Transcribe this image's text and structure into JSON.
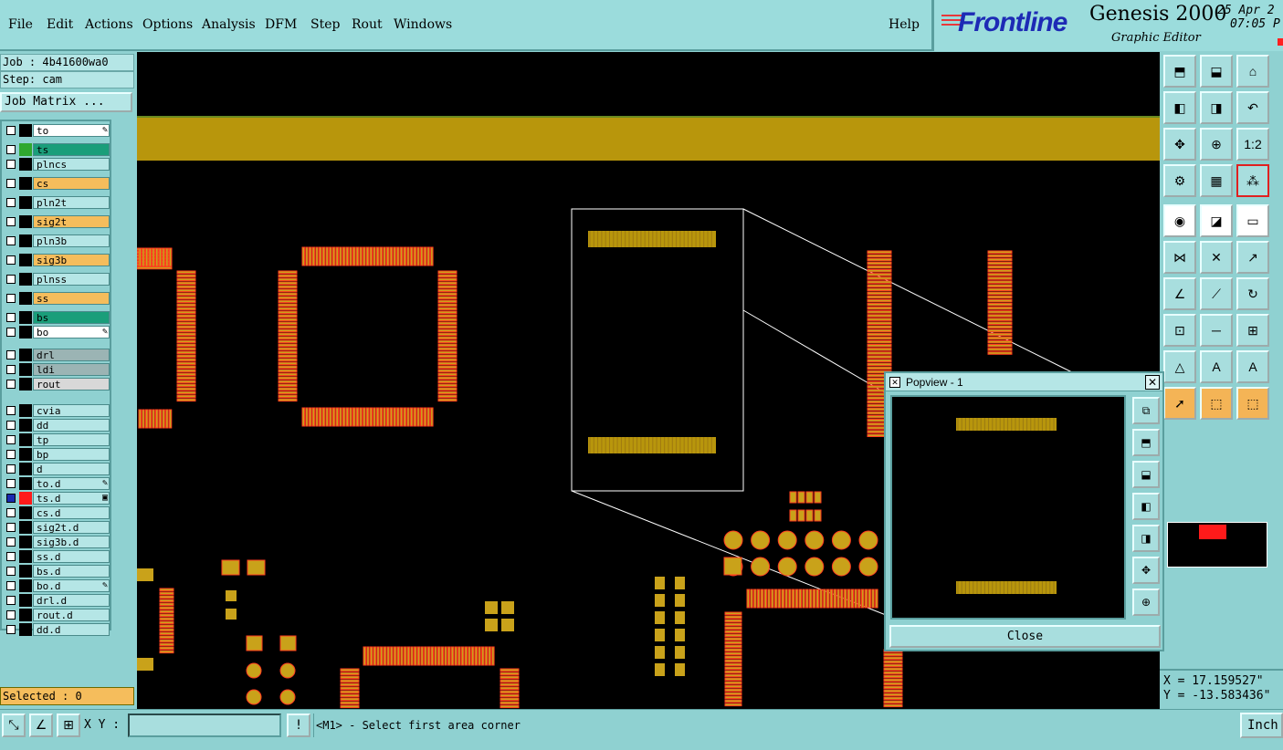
{
  "menu": {
    "items": [
      "File",
      "Edit",
      "Actions",
      "Options",
      "Analysis",
      "DFM",
      "Step",
      "Rout",
      "Windows"
    ],
    "help": "Help"
  },
  "brand": {
    "logo": "Frontline",
    "product": "Genesis 2000",
    "subtitle": "Graphic Editor",
    "date": "25 Apr 2",
    "time": "07:05 P"
  },
  "job": {
    "job_line": "Job : 4b41600wa0",
    "step_line": "Step: cam",
    "matrix_button": "Job Matrix ..."
  },
  "colors": {
    "copper": "#b8960c",
    "pad_fill": "#c9a21a",
    "pad_edge": "#ff3b1f",
    "layer_orange": "#f5bd5c",
    "layer_green": "#1a9e7a",
    "layer_gray": "#9bb4b4",
    "panel_bg": "#8fd1d1"
  },
  "layers": [
    {
      "name": "to",
      "style": "white",
      "mark": "✎",
      "swatch": "#000000"
    },
    {
      "name": "ts",
      "style": "green",
      "mark": "",
      "swatch": "#2fa82f"
    },
    {
      "name": "plncs",
      "style": "cyan",
      "mark": "",
      "swatch": "#000000"
    },
    {
      "name": "cs",
      "style": "orange",
      "mark": "",
      "swatch": "#000000"
    },
    {
      "name": "pln2t",
      "style": "cyan",
      "mark": "",
      "swatch": "#000000"
    },
    {
      "name": "sig2t",
      "style": "orange",
      "mark": "",
      "swatch": "#000000"
    },
    {
      "name": "pln3b",
      "style": "cyan",
      "mark": "",
      "swatch": "#000000"
    },
    {
      "name": "sig3b",
      "style": "orange",
      "mark": "",
      "swatch": "#000000"
    },
    {
      "name": "plnss",
      "style": "cyan",
      "mark": "",
      "swatch": "#000000"
    },
    {
      "name": "ss",
      "style": "orange",
      "mark": "",
      "swatch": "#000000"
    },
    {
      "name": "bs",
      "style": "green",
      "mark": "",
      "swatch": "#000000"
    },
    {
      "name": "bo",
      "style": "white",
      "mark": "✎",
      "swatch": "#000000"
    },
    {
      "name": "drl",
      "style": "gray",
      "mark": "",
      "swatch": "#000000"
    },
    {
      "name": "ldi",
      "style": "gray",
      "mark": "",
      "swatch": "#000000"
    },
    {
      "name": "rout",
      "style": "lightgray",
      "mark": "",
      "swatch": "#000000"
    },
    {
      "name": "cvia",
      "style": "cyan",
      "mark": "",
      "swatch": "#000000"
    },
    {
      "name": "dd",
      "style": "cyan",
      "mark": "",
      "swatch": "#000000"
    },
    {
      "name": "tp",
      "style": "cyan",
      "mark": "",
      "swatch": "#000000"
    },
    {
      "name": "bp",
      "style": "cyan",
      "mark": "",
      "swatch": "#000000"
    },
    {
      "name": "d",
      "style": "cyan",
      "mark": "",
      "swatch": "#000000"
    },
    {
      "name": "to.d",
      "style": "cyan",
      "mark": "✎",
      "swatch": "#000000"
    },
    {
      "name": "ts.d",
      "style": "cyan",
      "mark": "▣",
      "swatch": "#ff1a1a",
      "chk": "blue"
    },
    {
      "name": "cs.d",
      "style": "cyan",
      "mark": "",
      "swatch": "#000000"
    },
    {
      "name": "sig2t.d",
      "style": "cyan",
      "mark": "",
      "swatch": "#000000"
    },
    {
      "name": "sig3b.d",
      "style": "cyan",
      "mark": "",
      "swatch": "#000000"
    },
    {
      "name": "ss.d",
      "style": "cyan",
      "mark": "",
      "swatch": "#000000"
    },
    {
      "name": "bs.d",
      "style": "cyan",
      "mark": "",
      "swatch": "#000000"
    },
    {
      "name": "bo.d",
      "style": "cyan",
      "mark": "✎",
      "swatch": "#000000"
    },
    {
      "name": "drl.d",
      "style": "cyan",
      "mark": "",
      "swatch": "#000000"
    },
    {
      "name": "rout.d",
      "style": "cyan",
      "mark": "",
      "swatch": "#000000"
    },
    {
      "name": "dd.d",
      "style": "cyan",
      "mark": "",
      "swatch": "#000000"
    }
  ],
  "selected": "Selected : 0",
  "popview": {
    "title": "Popview - 1",
    "close_label": "Close"
  },
  "coords": {
    "x_line": "X = 17.159527\"",
    "y_line": "Y = -13.583436\""
  },
  "bottom": {
    "xy_label": "X Y :",
    "xy_value": "",
    "status": "<M1> - Select first area corner",
    "units": "Inch"
  },
  "tools": [
    {
      "icon": "window-up-icon",
      "glyph": "⬒",
      "style": ""
    },
    {
      "icon": "window-down-icon",
      "glyph": "⬓",
      "style": ""
    },
    {
      "icon": "home-icon",
      "glyph": "⌂",
      "style": ""
    },
    {
      "icon": "pan-left-icon",
      "glyph": "◧",
      "style": ""
    },
    {
      "icon": "pan-right-icon",
      "glyph": "◨",
      "style": ""
    },
    {
      "icon": "undo-view-icon",
      "glyph": "↶",
      "style": ""
    },
    {
      "icon": "zoom-fit-icon",
      "glyph": "✥",
      "style": ""
    },
    {
      "icon": "zoom-center-icon",
      "glyph": "⊕",
      "style": ""
    },
    {
      "icon": "scale-label",
      "glyph": "1:2",
      "style": ""
    },
    {
      "icon": "measure-tools-icon",
      "glyph": "⚙",
      "style": ""
    },
    {
      "icon": "grid-icon",
      "glyph": "▦",
      "style": ""
    },
    {
      "icon": "snap-icon",
      "glyph": "⁂",
      "style": "red-outline"
    },
    {
      "icon": "info-icon",
      "glyph": "◉",
      "style": "white"
    },
    {
      "icon": "select-box-icon",
      "glyph": "◪",
      "style": "white"
    },
    {
      "icon": "ruler-icon",
      "glyph": "▭",
      "style": "white"
    },
    {
      "icon": "connect-nodes-icon",
      "glyph": "⋈",
      "style": ""
    },
    {
      "icon": "cross-icon",
      "glyph": "✕",
      "style": ""
    },
    {
      "icon": "line-node-icon",
      "glyph": "↗",
      "style": ""
    },
    {
      "icon": "angle-line-icon",
      "glyph": "∠",
      "style": ""
    },
    {
      "icon": "diagonal-line-icon",
      "glyph": "⟋",
      "style": ""
    },
    {
      "icon": "arc-icon",
      "glyph": "↻",
      "style": ""
    },
    {
      "icon": "point-pad-icon",
      "glyph": "⊡",
      "style": ""
    },
    {
      "icon": "horizontal-line-icon",
      "glyph": "─",
      "style": ""
    },
    {
      "icon": "pad-marker-icon",
      "glyph": "⊞",
      "style": ""
    },
    {
      "icon": "triangle-text-icon",
      "glyph": "△",
      "style": ""
    },
    {
      "icon": "letter-a-icon",
      "glyph": "A",
      "style": ""
    },
    {
      "icon": "letter-a-alt-icon",
      "glyph": "A",
      "style": ""
    },
    {
      "icon": "pointer-icon",
      "glyph": "➚",
      "style": "orange"
    },
    {
      "icon": "select-pointer-icon",
      "glyph": "⬚",
      "style": "orange"
    },
    {
      "icon": "rotate-pointer-icon",
      "glyph": "⬚",
      "style": "orange"
    }
  ],
  "popview_tools": [
    {
      "icon": "popview-expand-icon",
      "glyph": "⧉"
    },
    {
      "icon": "popview-up-icon",
      "glyph": "⬒"
    },
    {
      "icon": "popview-down-icon",
      "glyph": "⬓"
    },
    {
      "icon": "popview-left-icon",
      "glyph": "◧"
    },
    {
      "icon": "popview-right-icon",
      "glyph": "◨"
    },
    {
      "icon": "popview-fit-icon",
      "glyph": "✥"
    },
    {
      "icon": "popview-center-icon",
      "glyph": "⊕"
    }
  ]
}
